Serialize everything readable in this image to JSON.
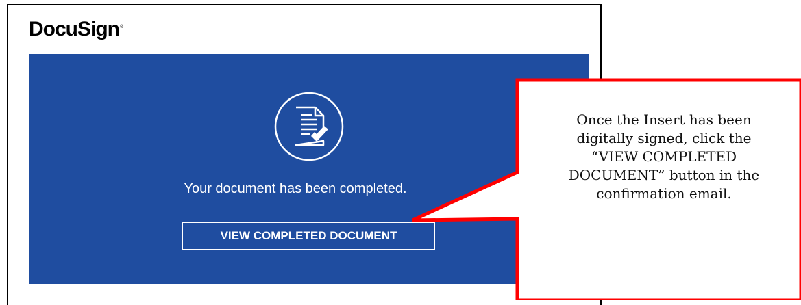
{
  "email": {
    "logo_text": "DocuSign",
    "message": "Your document has been completed.",
    "button_label": "VIEW COMPLETED DOCUMENT"
  },
  "callout": {
    "text_lines": [
      "Once the Insert has been",
      "digitally signed, click the",
      "“VIEW COMPLETED",
      "DOCUMENT” button in the",
      "confirmation email."
    ]
  },
  "colors": {
    "brand_blue": "#1f4da0",
    "callout_border": "#ff0000"
  },
  "icons": {
    "hero_icon": "document-check-icon"
  }
}
